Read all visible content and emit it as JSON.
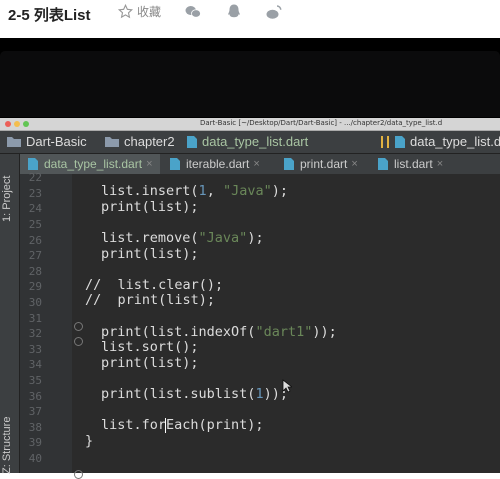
{
  "header": {
    "title": "2-5 列表List",
    "favorite_label": "收藏"
  },
  "ide": {
    "window_title": "Dart-Basic [~/Desktop/Dart/Dart-Basic] - .../chapter2/data_type_list.d",
    "breadcrumbs": [
      "Dart-Basic",
      "chapter2",
      "data_type_list.dart"
    ],
    "run_config": "data_type_list.d",
    "tabs": [
      {
        "label": "data_type_list.dart",
        "active": true
      },
      {
        "label": "iterable.dart",
        "active": false
      },
      {
        "label": "print.dart",
        "active": false
      },
      {
        "label": "list.dart",
        "active": false
      }
    ],
    "tab_close": "×",
    "sidebar": {
      "project": "1: Project",
      "structure": "Z: Structure"
    },
    "line_numbers": [
      "22",
      "23",
      "24",
      "25",
      "26",
      "27",
      "28",
      "29",
      "30",
      "31",
      "32",
      "33",
      "34",
      "35",
      "36",
      "37",
      "38",
      "39",
      "40"
    ],
    "code": {
      "l23": {
        "a": "list.insert(",
        "b": "1",
        "c": ", ",
        "d": "\"Java\"",
        "e": ");"
      },
      "l24": "print(list);",
      "l26": {
        "a": "list.remove(",
        "b": "\"Java\"",
        "c": ");"
      },
      "l27": "print(list);",
      "l29": "//  list.clear();",
      "l30": "//  print(list);",
      "l32": {
        "a": "print(list.indexOf(",
        "b": "\"dart1\"",
        "c": "));"
      },
      "l33": "list.sort();",
      "l34": "print(list);",
      "l36": {
        "a": "print(list.sublist(",
        "b": "1",
        "c": "));"
      },
      "l38": "list.forEach(print);",
      "l39": "}"
    }
  },
  "colors": {
    "editor_bg": "#2b2b2b",
    "string": "#6a8759",
    "number": "#6897bb",
    "comment": "#808080"
  }
}
